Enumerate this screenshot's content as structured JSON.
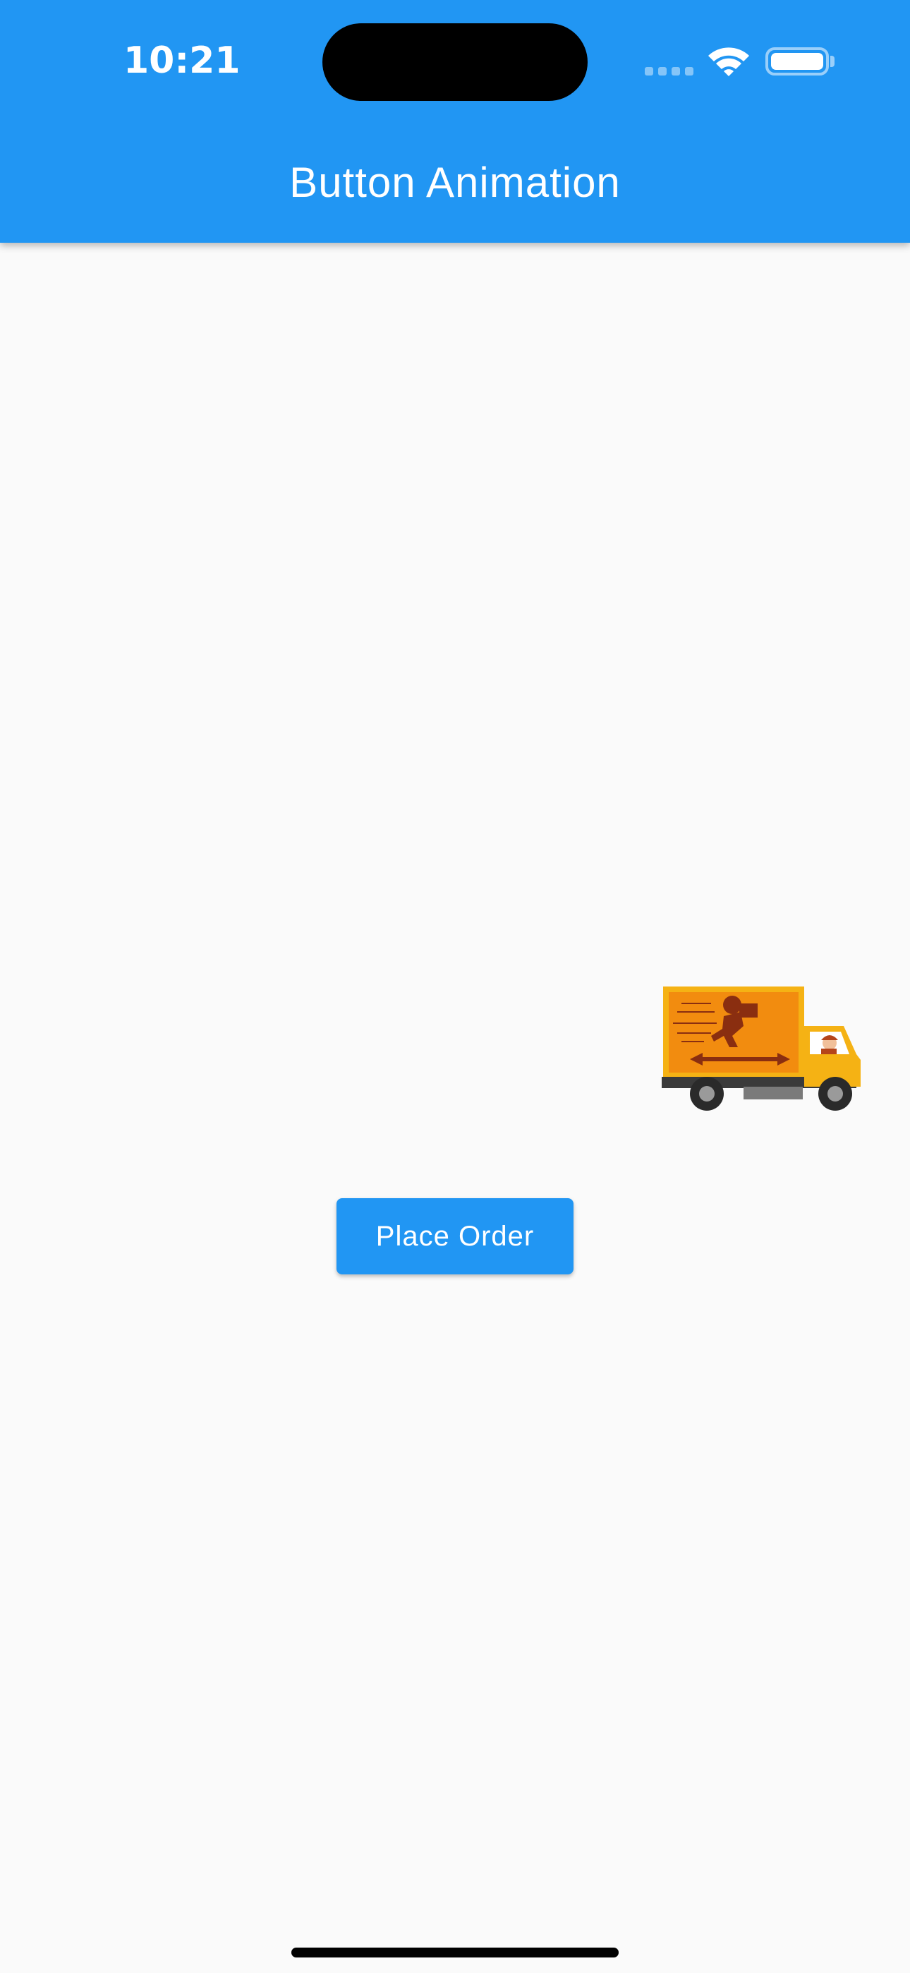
{
  "status_bar": {
    "time": "10:21"
  },
  "app_bar": {
    "title": "Button Animation",
    "color": "#2196f3"
  },
  "main": {
    "truck_icon": "delivery-truck-icon",
    "place_order_label": "Place Order"
  },
  "colors": {
    "primary": "#2196f3",
    "background": "#fafafa",
    "truck_body": "#f28c0f"
  }
}
